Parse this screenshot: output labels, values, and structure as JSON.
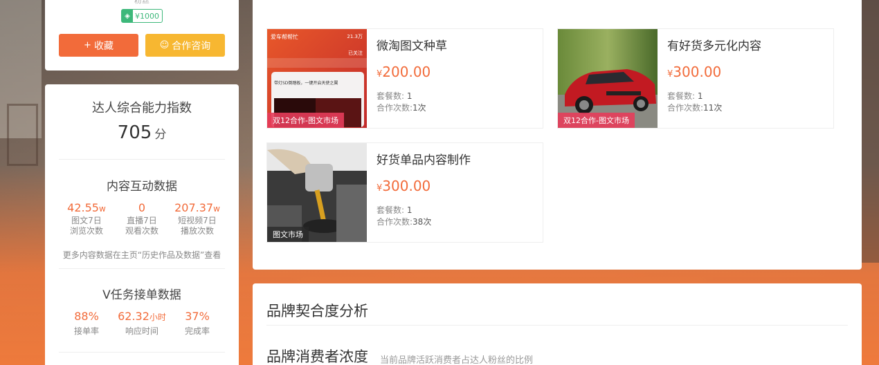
{
  "profile": {
    "fans_label": "粉丝",
    "price": "¥1000",
    "favorite_label": "收藏",
    "consult_label": "合作咨询"
  },
  "ability": {
    "title": "达人综合能力指数",
    "score": "705",
    "score_unit": "分"
  },
  "interaction": {
    "title": "内容互动数据",
    "stats": [
      {
        "value": "42.55",
        "unit": "w",
        "label1": "图文7日",
        "label2": "浏览次数"
      },
      {
        "value": "0",
        "unit": "",
        "label1": "直播7日",
        "label2": "观看次数"
      },
      {
        "value": "207.37",
        "unit": "w",
        "label1": "短视频7日",
        "label2": "播放次数"
      }
    ],
    "note": "更多内容数据在主页“历史作品及数据”查看"
  },
  "vtask": {
    "title": "V任务接单数据",
    "stats": [
      {
        "value": "88%",
        "unit": "",
        "label": "接单率"
      },
      {
        "value": "62.32",
        "unit": "小时",
        "label": "响应时间"
      },
      {
        "value": "37%",
        "unit": "",
        "label": "完成率"
      }
    ]
  },
  "products": [
    {
      "title": "微淘图文种草",
      "currency": "¥",
      "price": "200.00",
      "package_label": "套餐数:",
      "package": "1",
      "coop_label": "合作次数:",
      "coop": "1次",
      "tag": "双12合作-图文市场",
      "thumb_text": {
        "name": "爱车帮帮忙",
        "count": "21.3万",
        "follow": "已关注",
        "post": "带灯SD倒踏板，一键开启天使之翼"
      }
    },
    {
      "title": "有好货多元化内容",
      "currency": "¥",
      "price": "300.00",
      "package_label": "套餐数:",
      "package": "1",
      "coop_label": "合作次数:",
      "coop": "11次",
      "tag": "双12合作-图文市场"
    },
    {
      "title": "好货单品内容制作",
      "currency": "¥",
      "price": "300.00",
      "package_label": "套餐数:",
      "package": "1",
      "coop_label": "合作次数:",
      "coop": "38次",
      "tag": "图文市场"
    }
  ],
  "brand": {
    "title": "品牌契合度分析",
    "sub_title": "品牌消费者浓度",
    "sub_desc": "当前品牌活跃消费者占达人粉丝的比例"
  },
  "colors": {
    "accent": "#f26b3a",
    "consult": "#f7b731",
    "badge_green": "#3db87a",
    "tag_pink": "#e63c5a"
  }
}
